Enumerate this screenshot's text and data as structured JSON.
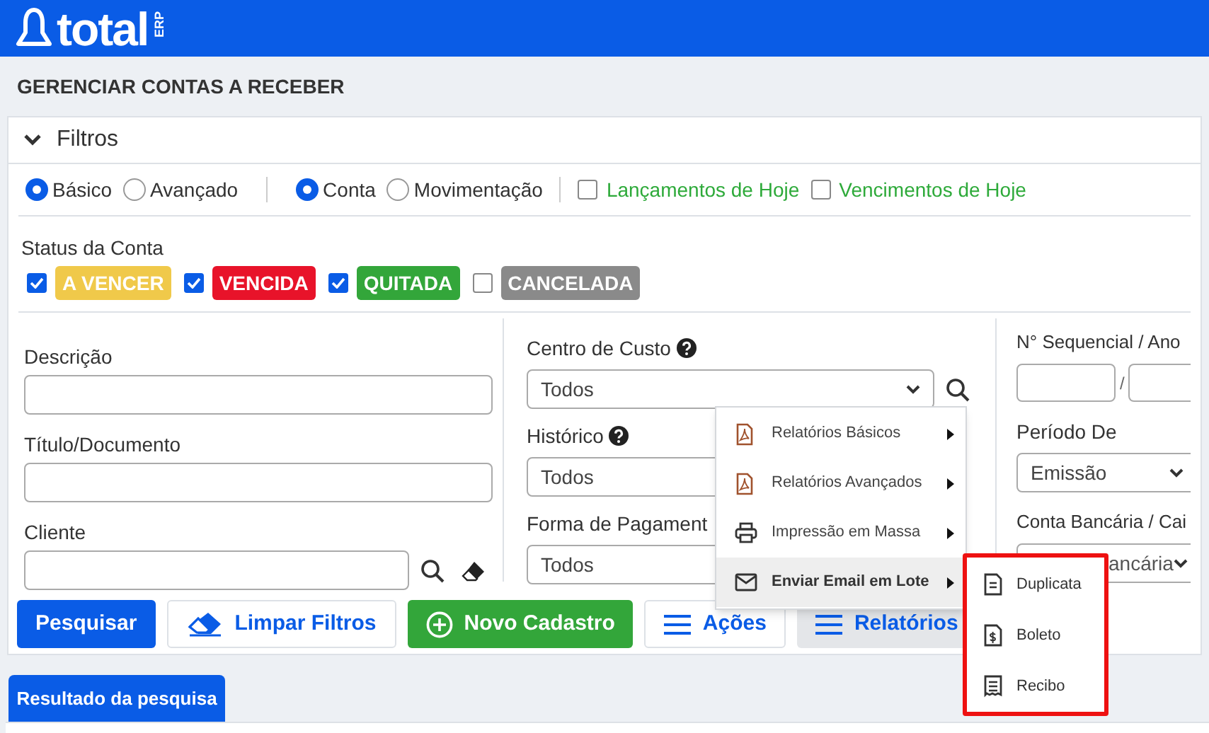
{
  "app": {
    "logo": "total",
    "logo_badge": "ERP"
  },
  "page_title": "GERENCIAR CONTAS A RECEBER",
  "filters_panel": {
    "title": "Filtros",
    "expanded": true
  },
  "mode_options": [
    {
      "label": "Básico",
      "selected": true
    },
    {
      "label": "Avançado",
      "selected": false
    }
  ],
  "scope_options": [
    {
      "label": "Conta",
      "selected": true
    },
    {
      "label": "Movimentação",
      "selected": false
    }
  ],
  "quick_filters": [
    {
      "label": "Lançamentos de Hoje",
      "checked": false
    },
    {
      "label": "Vencimentos de Hoje",
      "checked": false
    }
  ],
  "status": {
    "label": "Status da Conta",
    "items": [
      {
        "label": "A VENCER",
        "checked": true,
        "color": "#f0c94a"
      },
      {
        "label": "VENCIDA",
        "checked": true,
        "color": "#e8132a"
      },
      {
        "label": "QUITADA",
        "checked": true,
        "color": "#33a63a"
      },
      {
        "label": "CANCELADA",
        "checked": false,
        "color": "#8a8a8a"
      }
    ]
  },
  "left_fields": [
    {
      "label": "Descrição",
      "kind": "text"
    },
    {
      "label": "Título/Documento",
      "kind": "text"
    },
    {
      "label": "Cliente",
      "kind": "lookup"
    }
  ],
  "middle_fields": [
    {
      "label": "Centro de Custo",
      "help": true,
      "value": "Todos"
    },
    {
      "label": "Histórico",
      "help": true,
      "value": "Todos"
    },
    {
      "label": "Forma de Pagament",
      "help": false,
      "value": "Todos"
    }
  ],
  "right_fields": {
    "sequence_label": "N° Sequencial / Ano",
    "separator": "/",
    "period_label": "Período De",
    "period_value": "Emissão",
    "account_label": "Conta Bancária / Cai",
    "account_value": "ancária"
  },
  "buttons": [
    {
      "label": "Pesquisar",
      "kind": "primary"
    },
    {
      "label": "Limpar Filtros",
      "kind": "eraser"
    },
    {
      "label": "Novo Cadastro",
      "kind": "add"
    },
    {
      "label": "Ações",
      "kind": "menu",
      "selected": false
    },
    {
      "label": "Relatórios",
      "kind": "menu",
      "selected": true
    }
  ],
  "reports_menu": [
    {
      "label": "Relatórios Básicos",
      "kind": "pdf",
      "selected": false
    },
    {
      "label": "Relatórios Avançados",
      "kind": "pdf",
      "selected": false
    },
    {
      "label": "Impressão em Massa",
      "kind": "printer",
      "selected": false
    },
    {
      "label": "Enviar Email em Lote",
      "kind": "mail",
      "selected": true
    }
  ],
  "email_submenu": [
    {
      "label": "Duplicata",
      "kind": "doc"
    },
    {
      "label": "Boleto",
      "kind": "bill"
    },
    {
      "label": "Recibo",
      "kind": "receipt"
    }
  ],
  "results_tab": {
    "label": "Resultado da pesquisa",
    "selected": true
  }
}
